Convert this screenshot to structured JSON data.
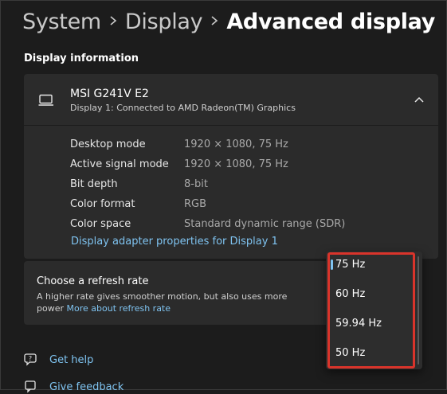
{
  "breadcrumb": {
    "items": [
      "System",
      "Display",
      "Advanced display"
    ]
  },
  "section_title": "Display information",
  "monitor": {
    "name": "MSI G241V E2",
    "subtitle": "Display 1: Connected to AMD Radeon(TM) Graphics",
    "icon": "monitor-icon",
    "info": [
      {
        "label": "Desktop mode",
        "value": "1920 × 1080, 75 Hz"
      },
      {
        "label": "Active signal mode",
        "value": "1920 × 1080, 75 Hz"
      },
      {
        "label": "Bit depth",
        "value": "8-bit"
      },
      {
        "label": "Color format",
        "value": "RGB"
      },
      {
        "label": "Color space",
        "value": "Standard dynamic range (SDR)"
      }
    ],
    "adapter_link": "Display adapter properties for Display 1"
  },
  "refresh": {
    "title": "Choose a refresh rate",
    "description": "A higher rate gives smoother motion, but also uses more power",
    "link": "More about refresh rate",
    "options": [
      "75 Hz",
      "60 Hz",
      "59.94 Hz",
      "50 Hz"
    ],
    "selected": "75 Hz"
  },
  "footer": {
    "help": "Get help",
    "feedback": "Give feedback"
  },
  "colors": {
    "background": "#1c1c1c",
    "card": "#2b2b2b",
    "accent_link": "#7fc3f0",
    "highlight_outline": "#d9342b"
  }
}
